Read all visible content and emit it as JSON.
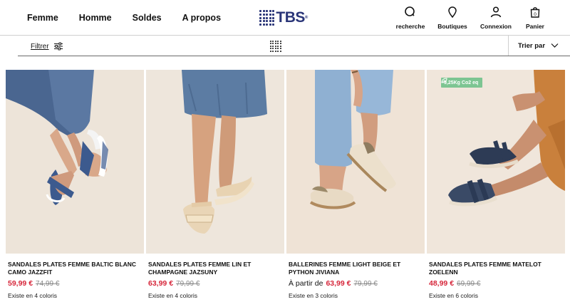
{
  "nav": {
    "items": [
      "Femme",
      "Homme",
      "Soldes",
      "A propos"
    ]
  },
  "logo": {
    "text": "TBS",
    "mark": "®"
  },
  "tools": [
    {
      "icon": "search-icon",
      "label": "recherche"
    },
    {
      "icon": "location-pin-icon",
      "label": "Boutiques"
    },
    {
      "icon": "user-icon",
      "label": "Connexion"
    },
    {
      "icon": "bag-icon",
      "label": "Panier",
      "count": "0"
    }
  ],
  "filterbar": {
    "filter_label": "Filtrer",
    "sort_label": "Trier par"
  },
  "products": [
    {
      "name": "SANDALES PLATES FEMME BALTIC BLANC CAMO JAZZFIT",
      "price_prefix": "",
      "price": "59,99 €",
      "old_price": "74,99 €",
      "colors": "Existe en 4 coloris",
      "badge": ""
    },
    {
      "name": "SANDALES PLATES FEMME LIN ET CHAMPAGNE JAZSUNY",
      "price_prefix": "",
      "price": "63,99 €",
      "old_price": "79,99 €",
      "colors": "Existe en 4 coloris",
      "badge": ""
    },
    {
      "name": "BALLERINES FEMME LIGHT BEIGE ET PYTHON JIVIANA",
      "price_prefix": "À partir de",
      "price": "63,99 €",
      "old_price": "79,99 €",
      "colors": "Existe en 3 coloris",
      "badge": ""
    },
    {
      "name": "SANDALES PLATES FEMME MATELOT ZOELENN",
      "price_prefix": "",
      "price": "48,99 €",
      "old_price": "69,99 €",
      "colors": "Existe en 6 coloris",
      "badge": "9,25Kg Co2 eq"
    }
  ],
  "colors": {
    "brand": "#2a3578",
    "sale_price": "#d6263a",
    "old_price": "#8a8a8a",
    "eco_badge": "#7dc592"
  }
}
